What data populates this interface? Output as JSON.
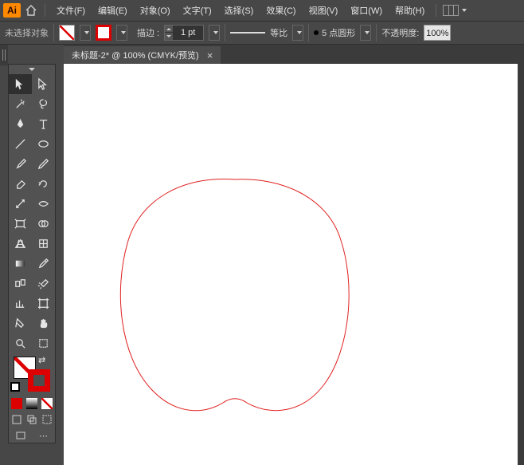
{
  "app": {
    "logo_text": "Ai"
  },
  "menu": [
    "文件(F)",
    "编辑(E)",
    "对象(O)",
    "文字(T)",
    "选择(S)",
    "效果(C)",
    "视图(V)",
    "窗口(W)",
    "帮助(H)"
  ],
  "controlbar": {
    "no_selection": "未选择对象",
    "stroke_label": "描边 :",
    "stroke_weight": "1 pt",
    "variable_label": "等比",
    "brush_label": "5 点圆形",
    "opacity_label": "不透明度:",
    "opacity_value": "100%"
  },
  "tab": {
    "title": "未标题-2* @ 100% (CMYK/预览)",
    "close": "×"
  },
  "tools": {
    "names": [
      "selection-tool",
      "direct-selection-tool",
      "magic-wand-tool",
      "lasso-tool",
      "pen-tool",
      "type-tool",
      "line-segment-tool",
      "ellipse-tool",
      "paintbrush-tool",
      "pencil-tool",
      "eraser-tool",
      "rotate-tool",
      "scale-tool",
      "width-tool",
      "free-transform-tool",
      "shape-builder-tool",
      "perspective-grid-tool",
      "mesh-tool",
      "gradient-tool",
      "eyedropper-tool",
      "blend-tool",
      "symbol-sprayer-tool",
      "column-graph-tool",
      "artboard-tool",
      "slice-tool",
      "hand-tool",
      "zoom-tool",
      "print-tiling-tool"
    ]
  },
  "colors": {
    "accent": "#ff8a00",
    "stroke": "#d00",
    "canvas_stroke": "#e02020"
  }
}
